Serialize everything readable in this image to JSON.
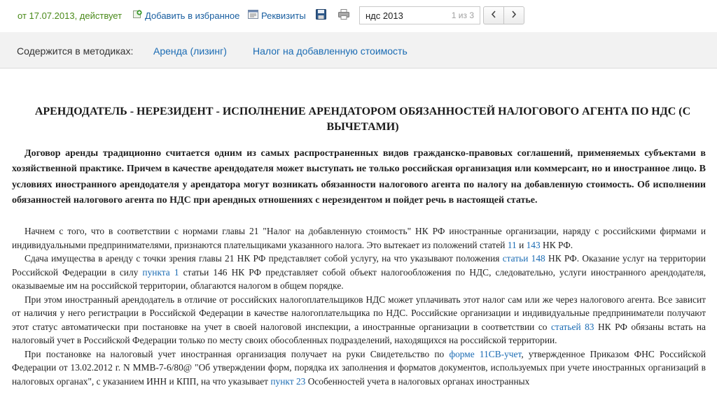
{
  "toolbar": {
    "status": "от 17.07.2013, действует",
    "favorite_label": "Добавить в избранное",
    "requisites_label": "Реквизиты",
    "search_value": "ндс 2013",
    "search_count": "1 из 3"
  },
  "methods": {
    "label": "Содержится в методиках:",
    "links": [
      "Аренда (лизинг)",
      "Налог на добавленную стоимость"
    ]
  },
  "doc": {
    "title": "АРЕНДОДАТЕЛЬ - НЕРЕЗИДЕНТ - ИСПОЛНЕНИЕ АРЕНДАТОРОМ ОБЯЗАННОСТЕЙ НАЛОГОВОГО АГЕНТА ПО НДС (С ВЫЧЕТАМИ)",
    "lead": "Договор аренды традиционно считается одним из самых распространенных видов гражданско-правовых соглашений, применяемых субъектами в хозяйственной практике. Причем в качестве арендодателя может выступать не только российская организация или коммерсант, но и иностранное лицо. В условиях иностранного арендодателя у арендатора могут возникать обязанности налогового агента по налогу на добавленную стоимость. Об исполнении обязанностей налогового агента по НДС при арендных отношениях с нерезидентом и пойдет речь в настоящей статье.",
    "p1": {
      "a": "Начнем с того, что в соответствии с нормами главы 21 \"Налог на добавленную стоимость\" НК РФ иностранные организации, наряду с российскими фирмами и индивидуальными предпринимателями, признаются плательщиками указанного налога. Это вытекает из положений статей ",
      "link1": "11",
      "b": " и ",
      "link2": "143",
      "c": " НК РФ."
    },
    "p2": {
      "a": "Сдача имущества в аренду с точки зрения главы 21 НК РФ представляет собой услугу, на что указывают положения ",
      "link1": "статьи 148",
      "b": " НК РФ. Оказание услуг на территории Российской Федерации в силу ",
      "link2": "пункта 1",
      "c": " статьи 146 НК РФ представляет собой объект налогообложения по НДС, следовательно, услуги иностранного арендодателя, оказываемые им на российской территории, облагаются налогом в общем порядке."
    },
    "p3": {
      "a": "При этом иностранный арендодатель в отличие от российских налогоплательщиков НДС может уплачивать этот налог сам или же через налогового агента. Все зависит от наличия у него регистрации в Российской Федерации в качестве налогоплательщика по НДС. Российские организации и индивидуальные предприниматели получают этот статус автоматически при постановке на учет в своей налоговой инспекции, а иностранные организации в соответствии со ",
      "link1": "статьей 83",
      "b": " НК РФ обязаны встать на налоговый учет в Российской Федерации только по месту своих обособленных подразделений, находящихся на российской территории."
    },
    "p4": {
      "a": "При постановке на налоговый учет иностранная организация получает на руки Свидетельство по ",
      "link1": "форме 11СВ-учет",
      "b": ", утвержденное Приказом ФНС Российской Федерации от 13.02.2012 г. N ММВ-7-6/80@ \"Об утверждении форм, порядка их заполнения и форматов документов, используемых при учете иностранных организаций в налоговых органах\", с указанием ИНН и КПП, на что указывает ",
      "link2": "пункт 23",
      "c": " Особенностей учета в налоговых органах иностранных"
    }
  },
  "icons": {
    "favorite": "add-favorite-icon",
    "requisites": "requisites-icon",
    "save": "save-icon",
    "print": "print-icon",
    "prev": "chevron-left-icon",
    "next": "chevron-right-icon"
  },
  "colors": {
    "status": "#4a8a1a",
    "link": "#1a6bb3",
    "methods_bg": "#f2f2f2"
  }
}
